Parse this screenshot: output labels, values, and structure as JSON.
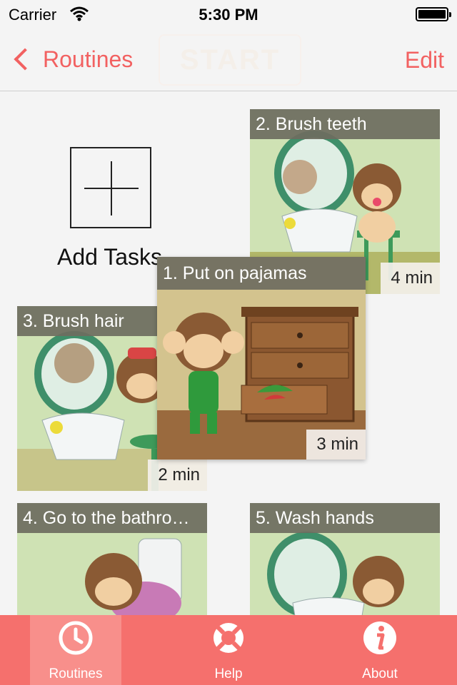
{
  "status_bar": {
    "carrier": "Carrier",
    "time": "5:30 PM"
  },
  "nav": {
    "back_label": "Routines",
    "edit_label": "Edit",
    "ghost_label": "START"
  },
  "add_tasks": {
    "label": "Add Tasks"
  },
  "tasks": [
    {
      "title": "1. Put on pajamas",
      "duration": "3 min"
    },
    {
      "title": "2. Brush teeth",
      "duration": "4 min"
    },
    {
      "title": "3. Brush hair",
      "duration": "2 min"
    },
    {
      "title": "4. Go to the bathro…",
      "duration": ""
    },
    {
      "title": "5. Wash hands",
      "duration": ""
    }
  ],
  "tabbar": {
    "items": [
      "Routines",
      "Help",
      "About"
    ],
    "active": "Routines"
  },
  "colors": {
    "accent": "#f26161",
    "tabbar": "#f5706d",
    "tab_active": "#f88f8b",
    "title_strip": "#6e6c60"
  },
  "icons": [
    "back-chevron-icon",
    "wifi-icon",
    "battery-icon",
    "plus-icon",
    "clock-icon",
    "lifebuoy-icon",
    "info-icon"
  ]
}
